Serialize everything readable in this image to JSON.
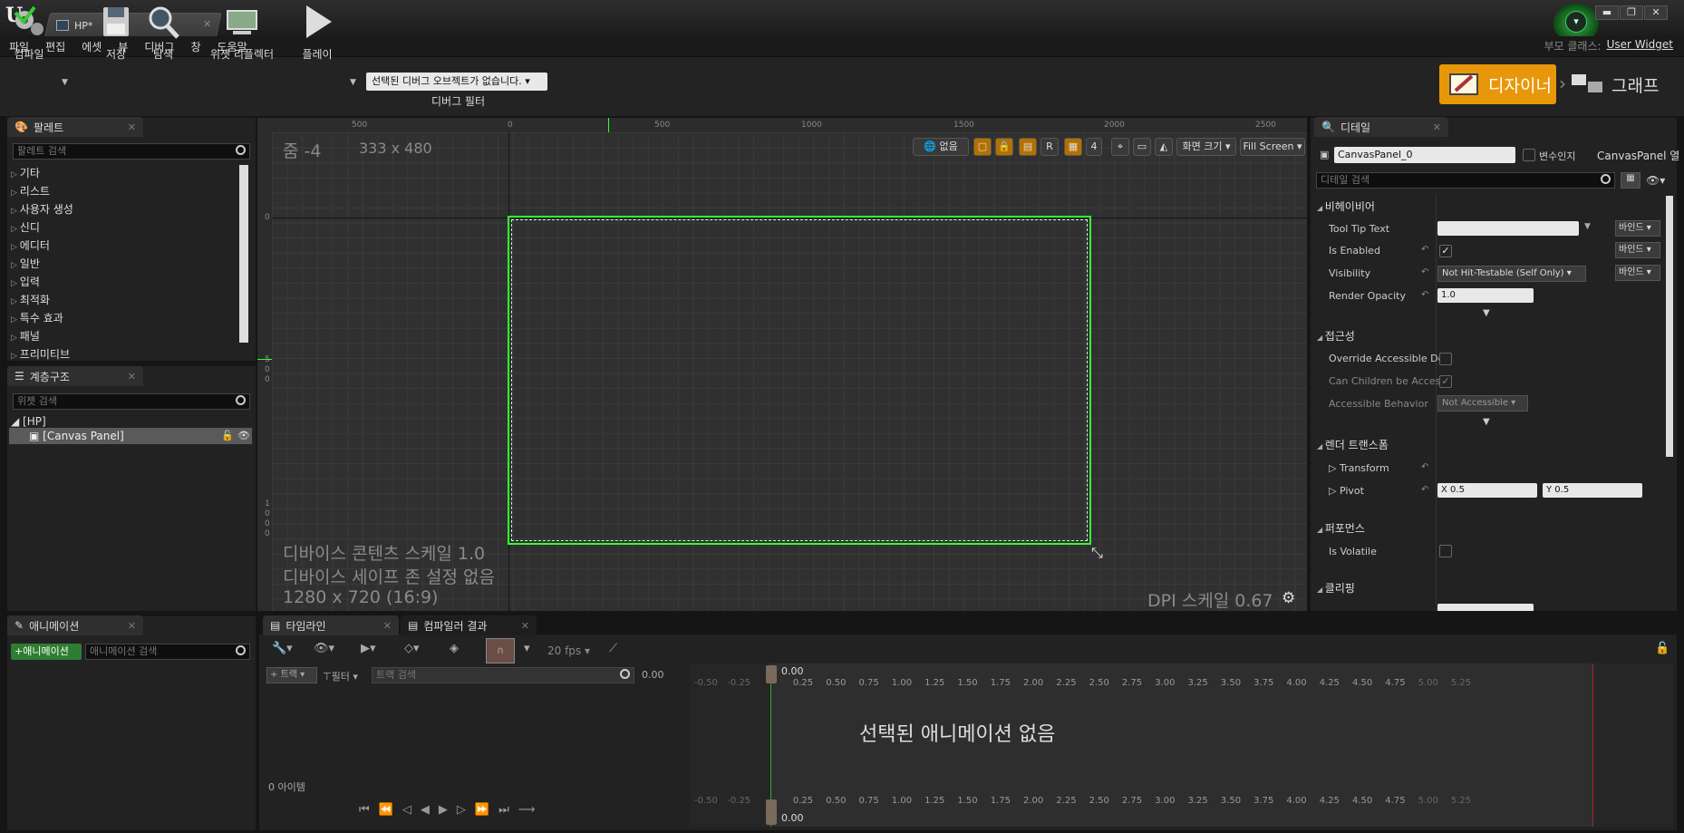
{
  "titlebar": {
    "doc_tab": "HP*"
  },
  "menu": [
    "파일",
    "편집",
    "에셋",
    "뷰",
    "디버그",
    "창",
    "도움말"
  ],
  "parent_class": {
    "label": "부모 클래스:",
    "value": "User Widget"
  },
  "toolbar": {
    "compile": "컴파일",
    "save": "저장",
    "browse": "탐색",
    "widget_reflector": "위젯 리플렉터",
    "play": "플레이",
    "debug_filter_value": "선택된 디버그 오브젝트가 없습니다.",
    "debug_filter_label": "디버그 필터",
    "designer": "디자이너",
    "graph": "그래프"
  },
  "palette": {
    "tab": "팔레트",
    "search_placeholder": "팔레트 검색",
    "items": [
      "기타",
      "리스트",
      "사용자 생성",
      "신디",
      "에디터",
      "일반",
      "입력",
      "최적화",
      "특수 효과",
      "패널",
      "프리미티브"
    ]
  },
  "hierarchy": {
    "tab": "계층구조",
    "search_placeholder": "위젯 검색",
    "root": "[HP]",
    "child": "[Canvas Panel]"
  },
  "viewport": {
    "zoom": "줌 -4",
    "size": "333 x 480",
    "ruler_top": [
      "500",
      "0",
      "500",
      "1000",
      "1500",
      "2000",
      "2500"
    ],
    "ruler_left": [
      "0",
      "5",
      "0",
      "0",
      "1",
      "0",
      "0",
      "0"
    ],
    "dpi_label": "없음",
    "screen_size": "화면 크기",
    "fill_screen": "Fill Screen",
    "r_label": "R",
    "grid_snap": "4",
    "device_scale": "디바이스 콘텐츠 스케일 1.0",
    "safe_zone": "디바이스 세이프 존 설정 없음",
    "resolution": "1280 x 720 (16:9)",
    "dpi_scale": "DPI 스케일 0.67"
  },
  "details": {
    "tab": "디테일",
    "name": "CanvasPanel_0",
    "is_variable": "변수인지",
    "class_label": "CanvasPanel 열",
    "search_placeholder": "디테일 검색",
    "sections": {
      "behavior": "비헤이비어",
      "accessibility": "접근성",
      "render_transform": "렌더 트랜스폼",
      "performance": "퍼포먼스",
      "clipping": "클리핑"
    },
    "rows": {
      "tooltip": "Tool Tip Text",
      "enabled": "Is Enabled",
      "visibility": "Visibility",
      "visibility_value": "Not Hit-Testable (Self Only)",
      "opacity": "Render Opacity",
      "opacity_value": "1.0",
      "override_acc": "Override Accessible De",
      "children_acc": "Can Children be Access",
      "acc_behavior": "Accessible Behavior",
      "acc_behavior_value": "Not Accessible",
      "transform": "Transform",
      "pivot": "Pivot",
      "pivot_x": "X  0.5",
      "pivot_y": "Y  0.5",
      "volatile": "Is Volatile"
    },
    "bind": "바인드"
  },
  "animation": {
    "tab": "애니메이션",
    "add": "애니메이션",
    "search_placeholder": "애니메이션 검색"
  },
  "timeline": {
    "tab": "타임라인",
    "compiler_tab": "컴파일러 결과",
    "fps": "20 fps",
    "track": "트랙",
    "filter": "필터",
    "track_search": "트랙 검색",
    "time_value": "0.00",
    "playhead": "0.00",
    "items_count": "0 아이템",
    "no_animation": "선택된 애니메이션 없음",
    "ticks": [
      "-0.50",
      "-0.25",
      "0.25",
      "0.50",
      "0.75",
      "1.00",
      "1.25",
      "1.50",
      "1.75",
      "2.00",
      "2.25",
      "2.50",
      "2.75",
      "3.00",
      "3.25",
      "3.50",
      "3.75",
      "4.00",
      "4.25",
      "4.50",
      "4.75",
      "5.00",
      "5.25"
    ]
  }
}
